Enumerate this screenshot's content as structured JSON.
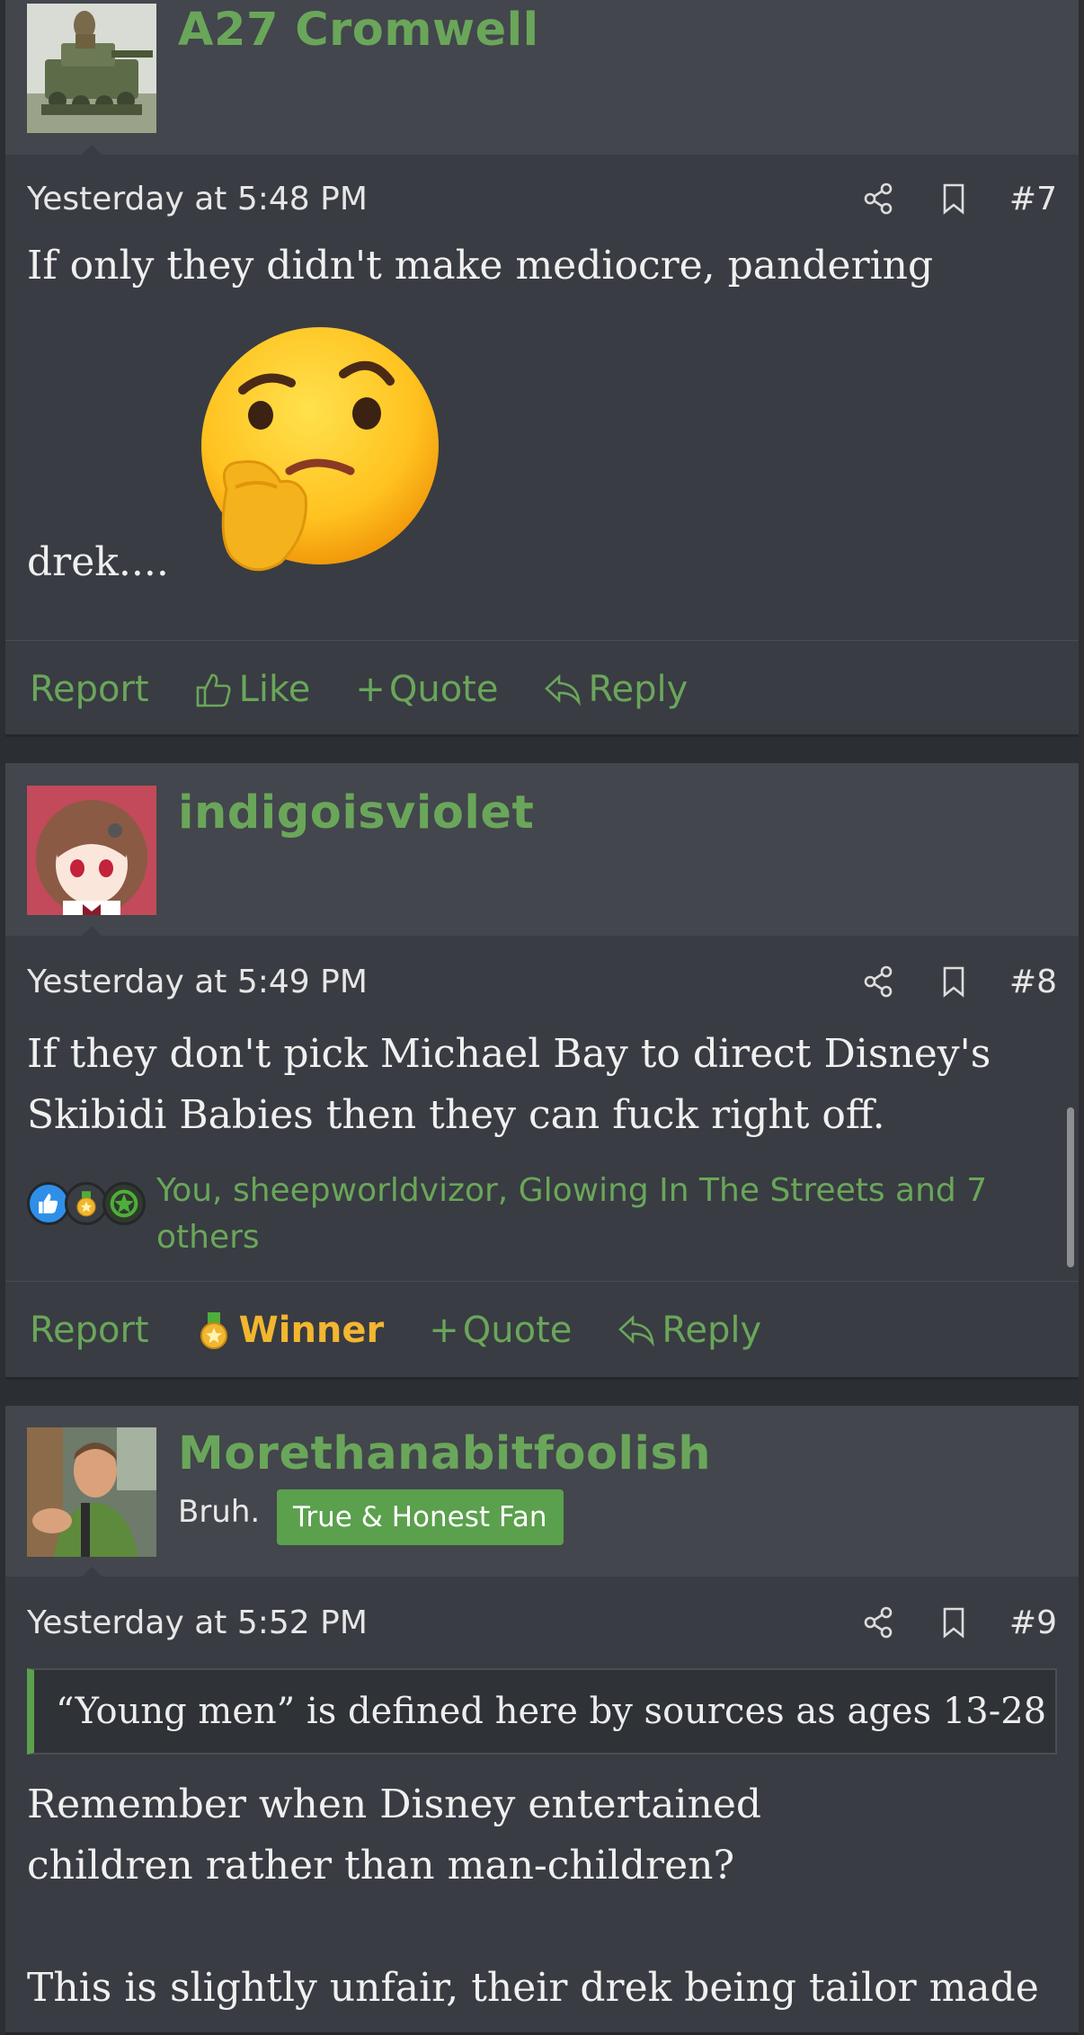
{
  "colors": {
    "accent": "#6aa65a",
    "background": "#2b2e33",
    "post_body": "#393c42",
    "post_header": "#43464c",
    "winner": "#f2b630",
    "badge": "#5ba04d"
  },
  "posts": [
    {
      "username": "A27 Cromwell",
      "avatar": "tank-avatar",
      "time": "Yesterday at 5:48 PM",
      "number": "#7",
      "text_line1": "If only they didn't make mediocre, pandering",
      "text_line2": "drek....",
      "emoji": "thinking-face",
      "actions": {
        "report": "Report",
        "like": "Like",
        "quote": "Quote",
        "reply": "Reply"
      }
    },
    {
      "username": "indigoisviolet",
      "avatar": "anime-girl-avatar",
      "time": "Yesterday at 5:49 PM",
      "number": "#8",
      "text": "If they don't pick Michael Bay to direct Disney's Skibidi Babies then they can fuck right off.",
      "reactions_text": "You, sheepworldvizor, Glowing In The Streets and 7 others",
      "actions": {
        "report": "Report",
        "winner": "Winner",
        "quote": "Quote",
        "reply": "Reply"
      }
    },
    {
      "username": "Morethanabitfoolish",
      "avatar": "man-photo-avatar",
      "user_title": "Bruh.",
      "badge": "True & Honest Fan",
      "time": "Yesterday at 5:52 PM",
      "number": "#9",
      "quote": "“Young men” is defined here by sources as ages 13-28",
      "text_para1": "Remember when Disney entertained children rather than man-children?",
      "text_para2": "This is slightly unfair, their drek being tailor made"
    }
  ],
  "icons": {
    "share": "share-icon",
    "bookmark": "bookmark-icon",
    "like": "thumbs-up-icon",
    "reply": "reply-arrow-icon",
    "winner": "medal-icon"
  }
}
